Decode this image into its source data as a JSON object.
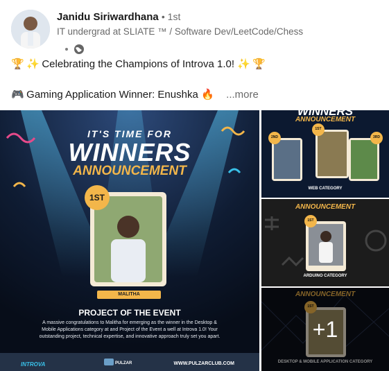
{
  "author": {
    "name": "Janidu Siriwardhana",
    "degree": "• 1st",
    "headline": "IT undergrad at SLIATE ™ / Software Dev/LeetCode/Chess"
  },
  "post": {
    "line1": "Celebrating the Champions of Introva 1.0!",
    "line2": "Gaming Application Winner: Enushka",
    "more_label": "...more"
  },
  "main_poster": {
    "tagline": "IT'S TIME FOR",
    "title": "WINNERS",
    "subtitle": "ANNOUNCEMENT",
    "rank": "1ST",
    "winner_name": "MALITHA",
    "award": "PROJECT OF THE EVENT",
    "description": "A massive congratulations to Malitha for emerging as the winner in the Desktop & Mobile Applications category at and Project of the Event a well at Introva 1.0! Your outstanding project, technical expertise, and innovative approach truly set you apart.",
    "footer_left": "INTROVA",
    "footer_mid": "PULZAR",
    "footer_url": "WWW.PULZARCLUB.COM"
  },
  "thumb1": {
    "title": "WINNERS",
    "subtitle": "ANNOUNCEMENT",
    "ranks": [
      "2ND",
      "1ST",
      "3RD"
    ],
    "category": "WEB CATEGORY"
  },
  "thumb2": {
    "subtitle": "ANNOUNCEMENT",
    "rank": "1ST",
    "category": "ARDUINO CATEGORY"
  },
  "thumb3": {
    "subtitle": "ANNOUNCEMENT",
    "rank": "1ST",
    "overlay": "+1",
    "category": "DESKTOP & MOBILE APPLICATION CATEGORY"
  },
  "colors": {
    "accent_gold": "#f3b64a",
    "poster_bg": "#0b1424",
    "text_secondary": "#666666"
  }
}
